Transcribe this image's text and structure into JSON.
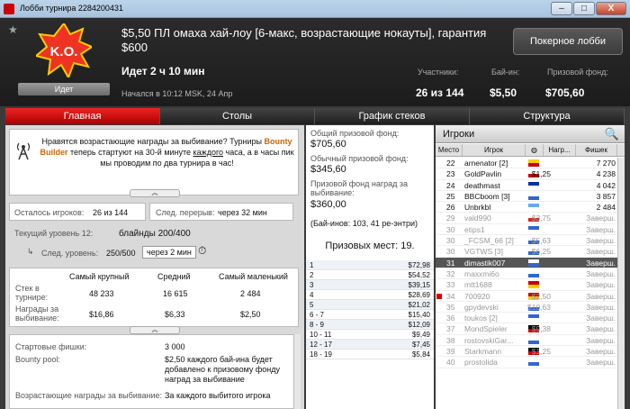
{
  "window": {
    "title": "Лобби турнира 2284200431",
    "minimize": "–",
    "maximize": "□",
    "close": "X"
  },
  "header": {
    "logo_text": "K.O.",
    "status_badge": "Идет",
    "tournament_name": "$5,50 ПЛ омаха хай-лоу [6-макс, возрастающие нокауты], гарантия $600",
    "lobby_button": "Покерное лобби",
    "running_time": "Идет 2 ч 10 мин",
    "started": "Начался в 10:12 MSK, 24 Апр",
    "participants_label": "Участники:",
    "participants_value": "26 из 144",
    "buyin_label": "Бай-ин:",
    "buyin_value": "$5,50",
    "prizepool_label": "Призовой фонд:",
    "prizepool_value": "$705,60"
  },
  "tabs": [
    "Главная",
    "Столы",
    "График стеков",
    "Структура"
  ],
  "news": {
    "p1": "Нравятся возрастающие награды за выбивание? Турниры ",
    "p2": "Bounty Builder",
    "p3": " теперь стартуют на 30-й минуте ",
    "p4": "каждого",
    "p5": " часа, а в часы пик мы проводим по два турнира в час!"
  },
  "players_left_label": "Осталось игроков:",
  "players_left_value": "26 из 144",
  "next_break_label": "След. перерыв:",
  "next_break_value": "через 32 мин",
  "current_level_label": "Текущий уровень 12:",
  "current_level_value": "блайнды 200/400",
  "next_level_label": "След. уровень:",
  "next_level_value": "250/500",
  "next_level_time": "через 2 мин",
  "stacks": {
    "headers": [
      "Самый крупный",
      "Средний",
      "Самый маленький"
    ],
    "rows": [
      {
        "label": "Стек в турнире:",
        "values": [
          "48 233",
          "16 615",
          "2 484"
        ]
      },
      {
        "label": "Награды за выбивание:",
        "values": [
          "$16,86",
          "$6,33",
          "$2,50"
        ]
      }
    ]
  },
  "info": [
    {
      "label": "Стартовые фишки:",
      "value": "3 000"
    },
    {
      "label": "Bounty pool:",
      "value": "$2,50 каждого бай-ина будет добавлено к призовому фонду наград за выбивание"
    },
    {
      "label": "Возрастающие награды за выбивание:",
      "value": "За каждого выбитого игрока"
    }
  ],
  "prizes": {
    "total_label": "Общий призовой фонд:",
    "total_value": "$705,60",
    "regular_label": "Обычный призовой фонд:",
    "regular_value": "$345,60",
    "bounty_label": "Призовой фонд наград за выбивание:",
    "bounty_value": "$360,00",
    "buyins_note": "(Бай-инов: 103, 41 ре-энтри)",
    "paid_places": "Призовых мест: 19."
  },
  "payouts": [
    {
      "place": "1",
      "amount": "$72,98"
    },
    {
      "place": "2",
      "amount": "$54,52"
    },
    {
      "place": "3",
      "amount": "$39,15"
    },
    {
      "place": "4",
      "amount": "$28,69"
    },
    {
      "place": "5",
      "amount": "$21,02"
    },
    {
      "place": "6 - 7",
      "amount": "$15,40"
    },
    {
      "place": "8 - 9",
      "amount": "$12,09"
    },
    {
      "place": "10 - 11",
      "amount": "$9,49"
    },
    {
      "place": "12 - 17",
      "amount": "$7,45"
    },
    {
      "place": "18 - 19",
      "amount": "$5,84"
    }
  ],
  "players_panel": {
    "title": "Игроки",
    "columns": [
      "Место",
      "Игрок",
      "",
      "Нагр...",
      "Фишек"
    ]
  },
  "players": [
    {
      "place": "22",
      "name": "arnenator [2]",
      "bounty": "",
      "chips": "7 270",
      "flag": [
        "#fc0",
        "#c00"
      ]
    },
    {
      "place": "23",
      "name": "GoldPavlin",
      "bounty": "$1,25",
      "chips": "4 238",
      "flag": [
        "#fff",
        "#c00"
      ]
    },
    {
      "place": "24",
      "name": "deathmast",
      "bounty": "",
      "chips": "4 042",
      "flag": [
        "#039",
        "#fff"
      ]
    },
    {
      "place": "25",
      "name": "BBCboom [3]",
      "bounty": "",
      "chips": "3 857",
      "flag": [
        "#fff",
        "#36c"
      ]
    },
    {
      "place": "26",
      "name": "Unbrkbl",
      "bounty": "",
      "chips": "2 484",
      "flag": [
        "#6ae",
        "#fff"
      ]
    },
    {
      "place": "29",
      "name": "vald990",
      "bounty": "$3,75",
      "chips": "Заверш.",
      "flag": [
        "#fff",
        "#d22"
      ]
    },
    {
      "place": "30",
      "name": "etips1",
      "bounty": "",
      "chips": "Заверш.",
      "flag": [
        "#36c",
        "#fff"
      ]
    },
    {
      "place": "30",
      "name": "_FCSM_66 [2]",
      "bounty": "$5,63",
      "chips": "Заверш.",
      "flag": [
        "#fff",
        "#36c"
      ]
    },
    {
      "place": "30",
      "name": "VGTWS [3]",
      "bounty": "$6,25",
      "chips": "Заверш.",
      "flag": [
        "#fff",
        "#36c"
      ]
    },
    {
      "place": "31",
      "name": "dimastik007",
      "bounty": "",
      "chips": "Заверш.",
      "flag": [
        "#fff",
        "#36c"
      ],
      "selected": true
    },
    {
      "place": "32",
      "name": "maxxmi6o",
      "bounty": "",
      "chips": "Заверш.",
      "flag": [
        "#fff",
        "#36c"
      ]
    },
    {
      "place": "33",
      "name": "mtt1688",
      "bounty": "",
      "chips": "Заверш.",
      "flag": [
        "#c00",
        "#fc0"
      ]
    },
    {
      "place": "34",
      "name": "700920",
      "bounty": "$2,50",
      "chips": "Заверш.",
      "flag": [
        "#c00",
        "#fc0"
      ],
      "marker": true
    },
    {
      "place": "35",
      "name": "gpydevski",
      "bounty": "$10,63",
      "chips": "Заверш.",
      "flag": [
        "#fff",
        "#36c"
      ]
    },
    {
      "place": "36",
      "name": "toukos [2]",
      "bounty": "",
      "chips": "Заверш.",
      "flag": [
        "#36c",
        "#fff"
      ]
    },
    {
      "place": "37",
      "name": "MondSpieler",
      "bounty": "$9,38",
      "chips": "Заверш.",
      "flag": [
        "#000",
        "#c00"
      ]
    },
    {
      "place": "38",
      "name": "rostovskiGar...",
      "bounty": "",
      "chips": "Заверш.",
      "flag": [
        "#fff",
        "#36c"
      ]
    },
    {
      "place": "39",
      "name": "Starkmann",
      "bounty": "$1,25",
      "chips": "Заверш.",
      "flag": [
        "#000",
        "#c00"
      ]
    },
    {
      "place": "40",
      "name": "prostolida",
      "bounty": "",
      "chips": "Заверш.",
      "flag": [
        "#fff",
        "#36c"
      ]
    }
  ]
}
